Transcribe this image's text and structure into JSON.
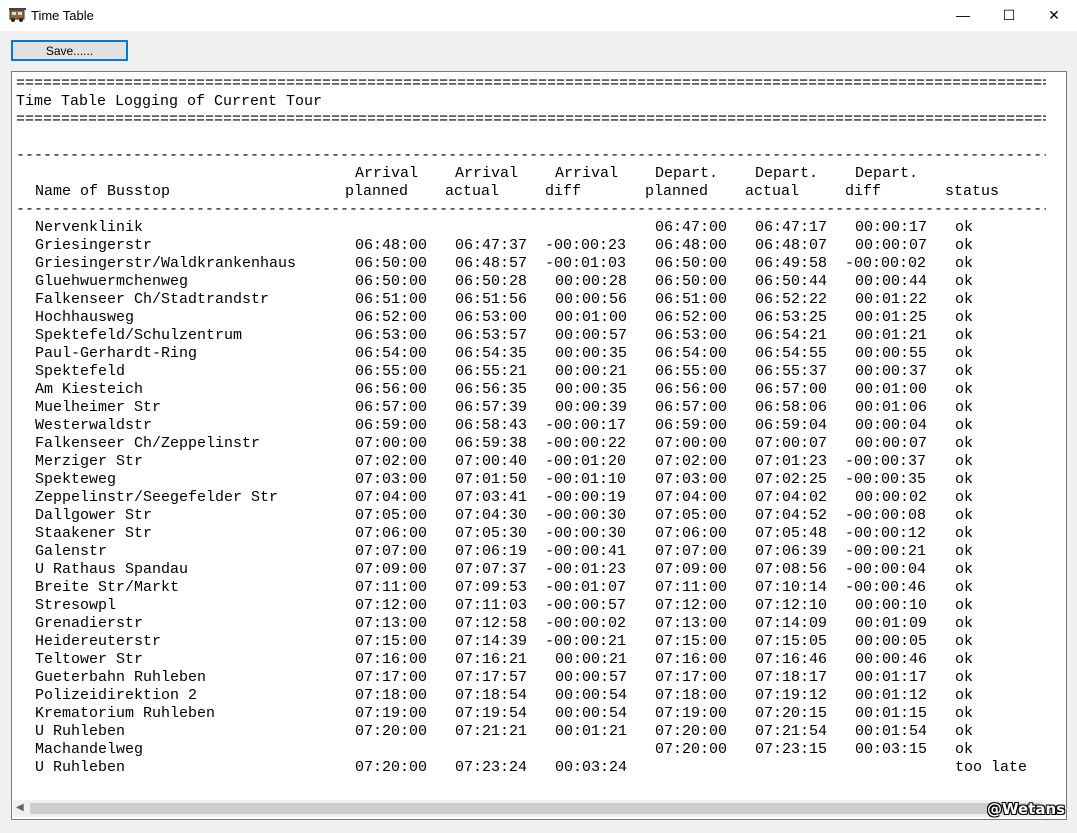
{
  "window": {
    "title": "Time Table",
    "min_glyph": "—",
    "max_glyph": "☐",
    "close_glyph": "✕"
  },
  "toolbar": {
    "save_label": "Save......"
  },
  "log": {
    "rule_double": "====================================================================================================================================",
    "rule_single": "------------------------------------------------------------------------------------------------------------------------------------",
    "heading": "Time Table Logging of Current Tour",
    "headers_top": {
      "arrival_planned": "Arrival",
      "arrival_actual": "Arrival",
      "arrival_diff": "Arrival",
      "depart_planned": "Depart.",
      "depart_actual": "Depart.",
      "depart_diff": "Depart."
    },
    "headers_bottom": {
      "name": "Name of Busstop",
      "arrival_planned": "planned",
      "arrival_actual": "actual",
      "arrival_diff": "diff",
      "depart_planned": "planned",
      "depart_actual": "actual",
      "depart_diff": "diff",
      "status": "status"
    },
    "rows": [
      [
        "Nervenklinik",
        "",
        "",
        "",
        "06:47:00",
        "06:47:17",
        "00:00:17",
        "ok"
      ],
      [
        "Griesingerstr",
        "06:48:00",
        "06:47:37",
        "-00:00:23",
        "06:48:00",
        "06:48:07",
        "00:00:07",
        "ok"
      ],
      [
        "Griesingerstr/Waldkrankenhaus",
        "06:50:00",
        "06:48:57",
        "-00:01:03",
        "06:50:00",
        "06:49:58",
        "-00:00:02",
        "ok"
      ],
      [
        "Gluehwuermchenweg",
        "06:50:00",
        "06:50:28",
        "00:00:28",
        "06:50:00",
        "06:50:44",
        "00:00:44",
        "ok"
      ],
      [
        "Falkenseer Ch/Stadtrandstr",
        "06:51:00",
        "06:51:56",
        "00:00:56",
        "06:51:00",
        "06:52:22",
        "00:01:22",
        "ok"
      ],
      [
        "Hochhausweg",
        "06:52:00",
        "06:53:00",
        "00:01:00",
        "06:52:00",
        "06:53:25",
        "00:01:25",
        "ok"
      ],
      [
        "Spektefeld/Schulzentrum",
        "06:53:00",
        "06:53:57",
        "00:00:57",
        "06:53:00",
        "06:54:21",
        "00:01:21",
        "ok"
      ],
      [
        "Paul-Gerhardt-Ring",
        "06:54:00",
        "06:54:35",
        "00:00:35",
        "06:54:00",
        "06:54:55",
        "00:00:55",
        "ok"
      ],
      [
        "Spektefeld",
        "06:55:00",
        "06:55:21",
        "00:00:21",
        "06:55:00",
        "06:55:37",
        "00:00:37",
        "ok"
      ],
      [
        "Am Kiesteich",
        "06:56:00",
        "06:56:35",
        "00:00:35",
        "06:56:00",
        "06:57:00",
        "00:01:00",
        "ok"
      ],
      [
        "Muelheimer Str",
        "06:57:00",
        "06:57:39",
        "00:00:39",
        "06:57:00",
        "06:58:06",
        "00:01:06",
        "ok"
      ],
      [
        "Westerwaldstr",
        "06:59:00",
        "06:58:43",
        "-00:00:17",
        "06:59:00",
        "06:59:04",
        "00:00:04",
        "ok"
      ],
      [
        "Falkenseer Ch/Zeppelinstr",
        "07:00:00",
        "06:59:38",
        "-00:00:22",
        "07:00:00",
        "07:00:07",
        "00:00:07",
        "ok"
      ],
      [
        "Merziger Str",
        "07:02:00",
        "07:00:40",
        "-00:01:20",
        "07:02:00",
        "07:01:23",
        "-00:00:37",
        "ok"
      ],
      [
        "Spekteweg",
        "07:03:00",
        "07:01:50",
        "-00:01:10",
        "07:03:00",
        "07:02:25",
        "-00:00:35",
        "ok"
      ],
      [
        "Zeppelinstr/Seegefelder Str",
        "07:04:00",
        "07:03:41",
        "-00:00:19",
        "07:04:00",
        "07:04:02",
        "00:00:02",
        "ok"
      ],
      [
        "Dallgower Str",
        "07:05:00",
        "07:04:30",
        "-00:00:30",
        "07:05:00",
        "07:04:52",
        "-00:00:08",
        "ok"
      ],
      [
        "Staakener Str",
        "07:06:00",
        "07:05:30",
        "-00:00:30",
        "07:06:00",
        "07:05:48",
        "-00:00:12",
        "ok"
      ],
      [
        "Galenstr",
        "07:07:00",
        "07:06:19",
        "-00:00:41",
        "07:07:00",
        "07:06:39",
        "-00:00:21",
        "ok"
      ],
      [
        "U Rathaus Spandau",
        "07:09:00",
        "07:07:37",
        "-00:01:23",
        "07:09:00",
        "07:08:56",
        "-00:00:04",
        "ok"
      ],
      [
        "Breite Str/Markt",
        "07:11:00",
        "07:09:53",
        "-00:01:07",
        "07:11:00",
        "07:10:14",
        "-00:00:46",
        "ok"
      ],
      [
        "Stresowpl",
        "07:12:00",
        "07:11:03",
        "-00:00:57",
        "07:12:00",
        "07:12:10",
        "00:00:10",
        "ok"
      ],
      [
        "Grenadierstr",
        "07:13:00",
        "07:12:58",
        "-00:00:02",
        "07:13:00",
        "07:14:09",
        "00:01:09",
        "ok"
      ],
      [
        "Heidereuterstr",
        "07:15:00",
        "07:14:39",
        "-00:00:21",
        "07:15:00",
        "07:15:05",
        "00:00:05",
        "ok"
      ],
      [
        "Teltower Str",
        "07:16:00",
        "07:16:21",
        "00:00:21",
        "07:16:00",
        "07:16:46",
        "00:00:46",
        "ok"
      ],
      [
        "Gueterbahn Ruhleben",
        "07:17:00",
        "07:17:57",
        "00:00:57",
        "07:17:00",
        "07:18:17",
        "00:01:17",
        "ok"
      ],
      [
        "Polizeidirektion 2",
        "07:18:00",
        "07:18:54",
        "00:00:54",
        "07:18:00",
        "07:19:12",
        "00:01:12",
        "ok"
      ],
      [
        "Krematorium Ruhleben",
        "07:19:00",
        "07:19:54",
        "00:00:54",
        "07:19:00",
        "07:20:15",
        "00:01:15",
        "ok"
      ],
      [
        "U Ruhleben",
        "07:20:00",
        "07:21:21",
        "00:01:21",
        "07:20:00",
        "07:21:54",
        "00:01:54",
        "ok"
      ],
      [
        "Machandelweg",
        "",
        "",
        "",
        "07:20:00",
        "07:23:15",
        "00:03:15",
        "ok"
      ],
      [
        "U Ruhleben",
        "07:20:00",
        "07:23:24",
        "00:03:24",
        "",
        "",
        "",
        "too late"
      ]
    ]
  },
  "watermark": "@Wetans"
}
